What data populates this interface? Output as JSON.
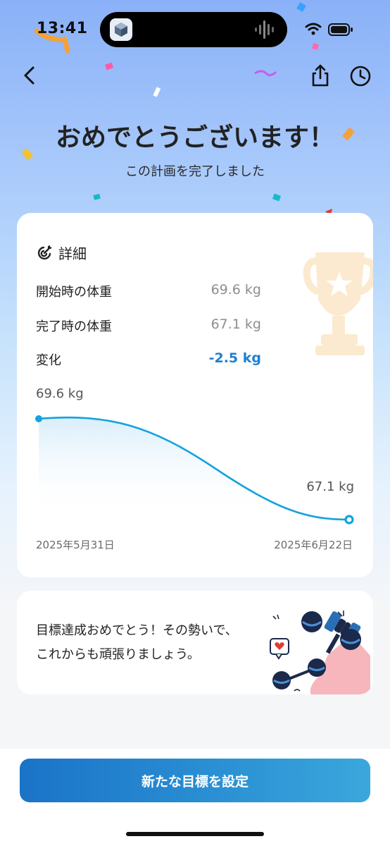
{
  "status_bar": {
    "time": "13:41"
  },
  "header": {
    "back_icon": "chevron-left-icon",
    "share_icon": "share-icon",
    "history_icon": "clock-icon"
  },
  "hero": {
    "title": "おめでとうございます！",
    "subtitle": "この計画を完了しました"
  },
  "details": {
    "title": "詳細",
    "icon": "target-icon",
    "rows": [
      {
        "label": "開始時の体重",
        "value": "69.6 kg"
      },
      {
        "label": "完了時の体重",
        "value": "67.1 kg"
      },
      {
        "label": "変化",
        "value": "-2.5 kg"
      }
    ]
  },
  "chart_data": {
    "type": "line",
    "x": [
      "2025年5月31日",
      "2025年6月22日"
    ],
    "series": [
      {
        "values": [
          69.6,
          67.1
        ]
      }
    ],
    "point_labels": [
      "69.6 kg",
      "67.1 kg"
    ],
    "start_date": "2025年5月31日",
    "end_date": "2025年6月22日",
    "line_color": "#14a3dc"
  },
  "message": {
    "text": "目標達成おめでとう！その勢いで、これからも頑張りましょう。"
  },
  "cta": {
    "label": "新たな目標を設定"
  },
  "colors": {
    "accent": "#1a73c8",
    "change_value": "#1e7fd2",
    "chart_line": "#14a3dc"
  }
}
